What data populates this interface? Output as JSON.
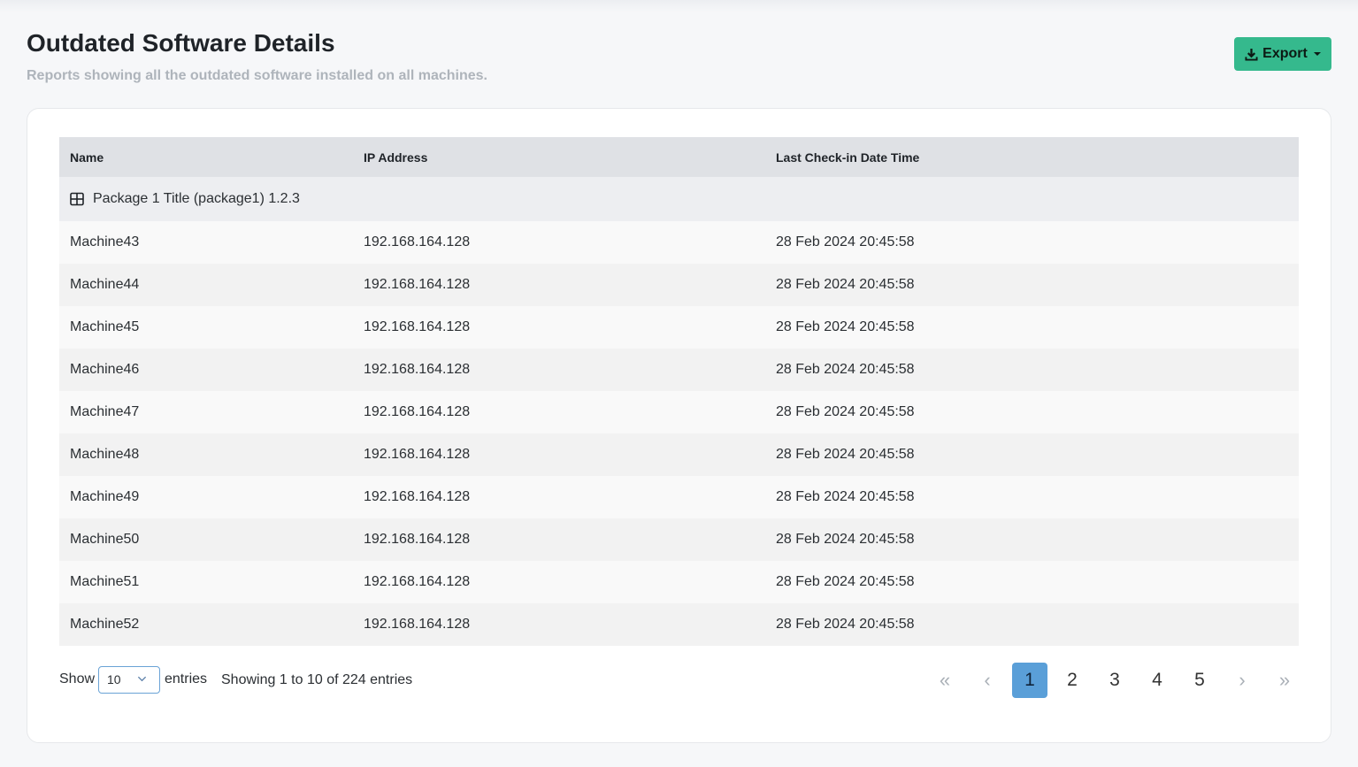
{
  "header": {
    "title": "Outdated Software Details",
    "subtitle": "Reports showing all the outdated software installed on all machines.",
    "export_label": "Export"
  },
  "table": {
    "columns": [
      "Name",
      "IP Address",
      "Last Check-in Date Time"
    ],
    "group_label": "Package 1 Title (package1) 1.2.3",
    "rows": [
      {
        "name": "Machine43",
        "ip": "192.168.164.128",
        "checkin": "28 Feb 2024 20:45:58"
      },
      {
        "name": "Machine44",
        "ip": "192.168.164.128",
        "checkin": "28 Feb 2024 20:45:58"
      },
      {
        "name": "Machine45",
        "ip": "192.168.164.128",
        "checkin": "28 Feb 2024 20:45:58"
      },
      {
        "name": "Machine46",
        "ip": "192.168.164.128",
        "checkin": "28 Feb 2024 20:45:58"
      },
      {
        "name": "Machine47",
        "ip": "192.168.164.128",
        "checkin": "28 Feb 2024 20:45:58"
      },
      {
        "name": "Machine48",
        "ip": "192.168.164.128",
        "checkin": "28 Feb 2024 20:45:58"
      },
      {
        "name": "Machine49",
        "ip": "192.168.164.128",
        "checkin": "28 Feb 2024 20:45:58"
      },
      {
        "name": "Machine50",
        "ip": "192.168.164.128",
        "checkin": "28 Feb 2024 20:45:58"
      },
      {
        "name": "Machine51",
        "ip": "192.168.164.128",
        "checkin": "28 Feb 2024 20:45:58"
      },
      {
        "name": "Machine52",
        "ip": "192.168.164.128",
        "checkin": "28 Feb 2024 20:45:58"
      }
    ]
  },
  "footer": {
    "show_label": "Show",
    "page_size": "10",
    "entries_label": "entries",
    "info": "Showing 1 to 10 of 224 entries",
    "first": "«",
    "prev": "‹",
    "next": "›",
    "last": "»",
    "pages": [
      "1",
      "2",
      "3",
      "4",
      "5"
    ],
    "active_page": "1"
  },
  "colors": {
    "accent": "#35b98d",
    "active_page": "#5a9fd8",
    "header_bg": "#dfe1e5"
  },
  "icons": {
    "export": "download-icon",
    "group": "grid-icon",
    "select": "chevron-down-icon"
  }
}
